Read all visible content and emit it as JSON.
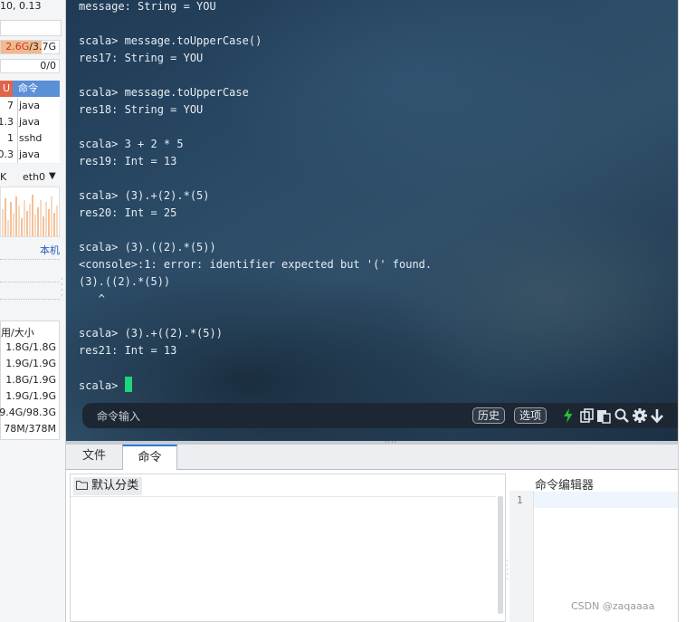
{
  "sidebar": {
    "load_text": "10, 0.13",
    "memory": {
      "used": "2.6G",
      "total": "3.7G",
      "fraction": 0.7
    },
    "swap": "0/0",
    "process_headers": {
      "cpu": "U",
      "command": "命令"
    },
    "processes": [
      {
        "cpu": "7",
        "name": "java"
      },
      {
        "cpu": "1.3",
        "name": "java"
      },
      {
        "cpu": "1",
        "name": "sshd"
      },
      {
        "cpu": "0.3",
        "name": "java"
      }
    ],
    "net_prefix": "K",
    "net_interface": "eth0",
    "host_link": "本机",
    "disk_header": "用/大小",
    "disks": [
      "1.8G/1.8G",
      "1.9G/1.9G",
      "1.8G/1.9G",
      "1.9G/1.9G",
      "9.4G/98.3G",
      "78M/378M"
    ]
  },
  "terminal": {
    "lines": [
      "message: String = YOU",
      "",
      "scala> message.toUpperCase()",
      "res17: String = YOU",
      "",
      "scala> message.toUpperCase",
      "res18: String = YOU",
      "",
      "scala> 3 + 2 * 5",
      "res19: Int = 13",
      "",
      "scala> (3).+(2).*(5)",
      "res20: Int = 25",
      "",
      "scala> (3).((2).*(5))",
      "<console>:1: error: identifier expected but '(' found.",
      "(3).((2).*(5))",
      "   ^",
      "",
      "scala> (3).+((2).*(5))",
      "res21: Int = 13",
      "",
      "scala> "
    ],
    "command_input_placeholder": "命令输入",
    "history_button": "历史",
    "options_button": "选项"
  },
  "tabs": {
    "files": "文件",
    "commands": "命令"
  },
  "command_panel": {
    "default_category": "默认分类"
  },
  "editor": {
    "title": "命令编辑器",
    "line_number": "1"
  },
  "watermark": "CSDN @zaqaaaa",
  "colors": {
    "cursor": "#1bd67a",
    "accent_tab": "#2a7bd4",
    "lightning": "#25c537"
  }
}
